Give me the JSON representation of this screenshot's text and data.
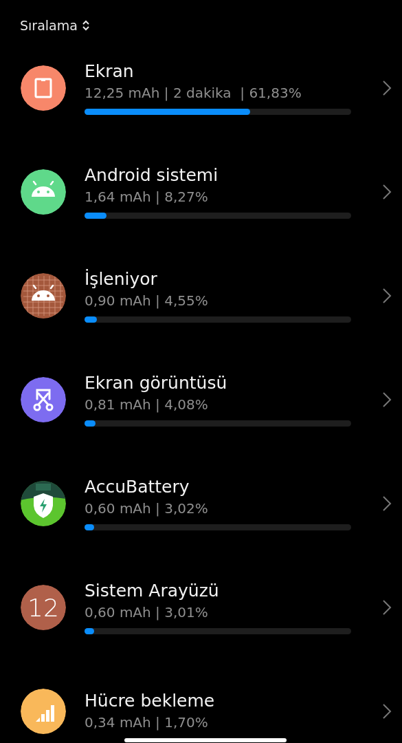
{
  "sort": {
    "label": "Sıralama"
  },
  "apps": [
    {
      "name": "Ekran",
      "usage": "12,25 mAh | 2 dakika  | 61,83%",
      "level": 0.62,
      "icon": {
        "kind": "screen",
        "color": "#f7876a"
      }
    },
    {
      "name": "Android sistemi",
      "usage": "1,64 mAh | 8,27%",
      "level": 0.083,
      "icon": {
        "kind": "android",
        "color": "#5fd98a"
      }
    },
    {
      "name": "İşleniyor",
      "usage": "0,90 mAh | 4,55%",
      "level": 0.046,
      "icon": {
        "kind": "android-grid",
        "color": "#a4583c"
      }
    },
    {
      "name": "Ekran görüntüsü",
      "usage": "0,81 mAh | 4,08%",
      "level": 0.041,
      "icon": {
        "kind": "scissors",
        "color": "#7d6cf0"
      }
    },
    {
      "name": "AccuBattery",
      "usage": "0,60 mAh | 3,02%",
      "level": 0.03,
      "icon": {
        "kind": "shield",
        "color": "#5cc52e"
      }
    },
    {
      "name": "Sistem Arayüzü",
      "usage": "0,60 mAh | 3,01%",
      "level": 0.03,
      "icon": {
        "kind": "number",
        "color": "#b0604a",
        "text": "12"
      }
    },
    {
      "name": "Hücre bekleme",
      "usage": "0,34 mAh | 1,70%",
      "icon": {
        "kind": "signal",
        "color": "#f9b85a"
      }
    }
  ]
}
